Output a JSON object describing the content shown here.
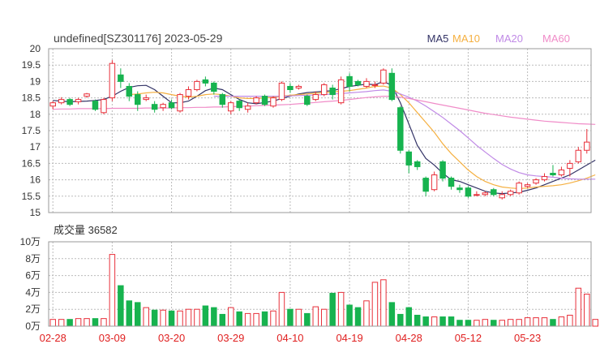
{
  "header": {
    "title": "undefined[SZ301176] 2023-05-29",
    "legend": [
      {
        "label": "MA5",
        "color": "#333366"
      },
      {
        "label": "MA10",
        "color": "#f5b041"
      },
      {
        "label": "MA20",
        "color": "#c08ae6"
      },
      {
        "label": "MA60",
        "color": "#f08cc8"
      }
    ]
  },
  "volume_panel": {
    "label": "成交量 36582"
  },
  "colors": {
    "up": "#e8303a",
    "down": "#17b34f",
    "grid": "#bbbbbb",
    "axis_text": "#333333",
    "date_text": "#e02020"
  },
  "chart_data": [
    {
      "type": "candlestick",
      "title": "undefined[SZ301176] 2023-05-29",
      "ylim": [
        15,
        20
      ],
      "yticks": [
        "20",
        "19.5",
        "19",
        "18.5",
        "18",
        "17.5",
        "17",
        "16.5",
        "16",
        "15.5",
        "15"
      ],
      "x_tick_labels": [
        {
          "index": 0,
          "label": "02-28"
        },
        {
          "index": 7,
          "label": "03-09"
        },
        {
          "index": 14,
          "label": "03-20"
        },
        {
          "index": 21,
          "label": "03-29"
        },
        {
          "index": 28,
          "label": "04-10"
        },
        {
          "index": 35,
          "label": "04-19"
        },
        {
          "index": 42,
          "label": "04-28"
        },
        {
          "index": 49,
          "label": "05-12"
        },
        {
          "index": 56,
          "label": "05-23"
        }
      ],
      "candles": [
        [
          18.25,
          18.35,
          18.15,
          18.4
        ],
        [
          18.35,
          18.45,
          18.3,
          18.52
        ],
        [
          18.45,
          18.3,
          18.25,
          18.5
        ],
        [
          18.38,
          18.45,
          18.3,
          18.5
        ],
        [
          18.55,
          18.62,
          18.5,
          18.65
        ],
        [
          18.4,
          18.15,
          18.1,
          18.45
        ],
        [
          18.05,
          18.45,
          18.0,
          18.5
        ],
        [
          18.5,
          19.55,
          18.4,
          19.65
        ],
        [
          19.2,
          19.0,
          18.8,
          19.4
        ],
        [
          18.85,
          18.55,
          18.4,
          18.95
        ],
        [
          18.6,
          18.3,
          18.1,
          18.7
        ],
        [
          18.45,
          18.5,
          18.4,
          18.6
        ],
        [
          18.3,
          18.15,
          18.05,
          18.4
        ],
        [
          18.2,
          18.3,
          18.1,
          18.35
        ],
        [
          18.35,
          18.2,
          18.15,
          18.45
        ],
        [
          18.1,
          18.6,
          18.05,
          18.65
        ],
        [
          18.55,
          18.75,
          18.45,
          18.85
        ],
        [
          18.75,
          19.0,
          18.7,
          19.05
        ],
        [
          19.05,
          18.95,
          18.85,
          19.15
        ],
        [
          18.95,
          18.7,
          18.6,
          19.0
        ],
        [
          18.6,
          18.3,
          18.2,
          18.65
        ],
        [
          18.1,
          18.35,
          18.0,
          18.4
        ],
        [
          18.4,
          18.2,
          18.1,
          18.45
        ],
        [
          18.15,
          18.25,
          18.05,
          18.35
        ],
        [
          18.35,
          18.5,
          18.3,
          18.55
        ],
        [
          18.55,
          18.3,
          18.25,
          18.6
        ],
        [
          18.25,
          18.5,
          18.2,
          18.55
        ],
        [
          18.45,
          18.95,
          18.4,
          19.0
        ],
        [
          18.85,
          18.75,
          18.65,
          18.95
        ],
        [
          18.8,
          18.85,
          18.75,
          18.9
        ],
        [
          18.55,
          18.3,
          18.25,
          18.6
        ],
        [
          18.45,
          18.6,
          18.4,
          18.7
        ],
        [
          18.6,
          18.9,
          18.55,
          18.95
        ],
        [
          18.8,
          18.6,
          18.45,
          18.9
        ],
        [
          18.35,
          19.05,
          18.3,
          19.15
        ],
        [
          19.15,
          18.85,
          18.7,
          19.25
        ],
        [
          19.0,
          18.9,
          18.85,
          19.05
        ],
        [
          18.85,
          19.0,
          18.8,
          19.1
        ],
        [
          18.9,
          18.9,
          18.8,
          19.0
        ],
        [
          18.95,
          19.35,
          18.9,
          19.4
        ],
        [
          19.25,
          18.45,
          18.4,
          19.4
        ],
        [
          18.2,
          16.9,
          16.8,
          18.25
        ],
        [
          16.85,
          16.45,
          16.2,
          16.9
        ],
        [
          16.55,
          16.4,
          16.3,
          16.6
        ],
        [
          16.05,
          15.65,
          15.5,
          16.1
        ],
        [
          15.7,
          16.15,
          15.65,
          16.25
        ],
        [
          16.55,
          16.05,
          15.95,
          16.6
        ],
        [
          16.05,
          15.8,
          15.7,
          16.1
        ],
        [
          15.75,
          15.7,
          15.6,
          15.85
        ],
        [
          15.75,
          15.5,
          15.45,
          15.8
        ],
        [
          15.55,
          15.55,
          15.5,
          15.65
        ],
        [
          15.55,
          15.6,
          15.5,
          15.65
        ],
        [
          15.7,
          15.55,
          15.5,
          15.75
        ],
        [
          15.45,
          15.55,
          15.4,
          15.65
        ],
        [
          15.55,
          15.65,
          15.5,
          15.7
        ],
        [
          15.6,
          15.9,
          15.55,
          15.95
        ],
        [
          15.8,
          15.85,
          15.75,
          15.9
        ],
        [
          15.9,
          16.0,
          15.85,
          16.05
        ],
        [
          16.0,
          16.1,
          15.95,
          16.2
        ],
        [
          16.2,
          16.15,
          16.1,
          16.45
        ],
        [
          16.15,
          16.3,
          16.1,
          16.4
        ],
        [
          16.35,
          16.5,
          16.1,
          16.6
        ],
        [
          16.55,
          16.9,
          16.5,
          17.0
        ],
        [
          16.9,
          17.15,
          16.8,
          17.55
        ]
      ],
      "ma_series": [
        {
          "name": "MA5",
          "color": "#333366",
          "values": [
            18.42,
            18.4,
            18.38,
            18.39,
            18.4,
            18.42,
            18.45,
            18.55,
            18.7,
            18.82,
            18.87,
            18.88,
            18.75,
            18.55,
            18.35,
            18.35,
            18.4,
            18.55,
            18.72,
            18.8,
            18.75,
            18.6,
            18.45,
            18.35,
            18.32,
            18.36,
            18.4,
            18.48,
            18.55,
            18.62,
            18.66,
            18.68,
            18.7,
            18.72,
            18.78,
            18.85,
            18.88,
            18.92,
            18.9,
            19.0,
            18.88,
            18.35,
            17.7,
            17.05,
            16.65,
            16.45,
            16.2,
            16.0,
            15.95,
            15.85,
            15.75,
            15.65,
            15.6,
            15.58,
            15.6,
            15.62,
            15.68,
            15.75,
            15.85,
            15.95,
            16.05,
            16.15,
            16.3,
            16.45,
            16.6
          ]
        },
        {
          "name": "MA10",
          "color": "#f5b041",
          "values": [
            null,
            null,
            null,
            null,
            null,
            null,
            null,
            null,
            null,
            18.6,
            18.62,
            18.65,
            18.67,
            18.65,
            18.6,
            18.55,
            18.52,
            18.55,
            18.6,
            18.62,
            18.6,
            18.55,
            18.5,
            18.48,
            18.48,
            18.5,
            18.52,
            18.55,
            18.58,
            18.6,
            18.62,
            18.64,
            18.66,
            18.68,
            18.7,
            18.72,
            18.76,
            18.8,
            18.85,
            18.86,
            18.8,
            18.6,
            18.35,
            18.05,
            17.75,
            17.45,
            17.1,
            16.8,
            16.55,
            16.3,
            16.1,
            15.95,
            15.85,
            15.78,
            15.75,
            15.73,
            15.75,
            15.78,
            15.8,
            15.82,
            15.85,
            15.9,
            15.97,
            16.05,
            16.15
          ]
        },
        {
          "name": "MA20",
          "color": "#c08ae6",
          "values": [
            null,
            null,
            null,
            null,
            null,
            null,
            null,
            null,
            null,
            null,
            null,
            null,
            null,
            null,
            null,
            null,
            null,
            null,
            null,
            18.55,
            18.55,
            18.55,
            18.55,
            18.55,
            18.55,
            18.55,
            18.55,
            18.55,
            18.56,
            18.57,
            18.58,
            18.59,
            18.6,
            18.62,
            18.63,
            18.65,
            18.67,
            18.69,
            18.72,
            18.74,
            18.7,
            18.62,
            18.52,
            18.4,
            18.25,
            18.08,
            17.9,
            17.7,
            17.5,
            17.28,
            17.05,
            16.85,
            16.65,
            16.47,
            16.33,
            16.22,
            16.15,
            16.12,
            16.1,
            16.08,
            16.05,
            16.03,
            16.02,
            16.02,
            16.02
          ]
        },
        {
          "name": "MA60",
          "color": "#f08cc8",
          "values": [
            18.15,
            18.16,
            18.16,
            18.17,
            18.17,
            18.17,
            18.17,
            18.18,
            18.18,
            18.18,
            18.18,
            18.19,
            18.19,
            18.19,
            18.19,
            18.2,
            18.2,
            18.21,
            18.21,
            18.22,
            18.22,
            18.23,
            18.24,
            18.25,
            18.26,
            18.27,
            18.28,
            18.29,
            18.3,
            18.32,
            18.34,
            18.36,
            18.38,
            18.4,
            18.42,
            18.45,
            18.48,
            18.51,
            18.53,
            18.55,
            18.55,
            18.52,
            18.48,
            18.43,
            18.38,
            18.33,
            18.28,
            18.23,
            18.18,
            18.13,
            18.08,
            18.03,
            17.99,
            17.95,
            17.91,
            17.88,
            17.85,
            17.82,
            17.79,
            17.77,
            17.75,
            17.73,
            17.71,
            17.7,
            17.69
          ]
        }
      ]
    },
    {
      "type": "bar",
      "title": "成交量 36582",
      "ylim": [
        0,
        100000
      ],
      "yticks": [
        "10万",
        "8万",
        "6万",
        "4万",
        "2万",
        "0万"
      ],
      "values": [
        8000,
        8000,
        8000,
        9000,
        9000,
        9000,
        9000,
        85000,
        48000,
        30000,
        28000,
        22000,
        19000,
        19000,
        18000,
        18000,
        20000,
        20000,
        24000,
        22000,
        14000,
        22000,
        17000,
        15000,
        15000,
        17000,
        18000,
        40000,
        20000,
        20000,
        15000,
        23000,
        20000,
        39000,
        40000,
        25000,
        22000,
        30000,
        52000,
        55000,
        28000,
        14000,
        22000,
        13000,
        11000,
        11000,
        11000,
        11000,
        7000,
        7000,
        7000,
        8000,
        7000,
        7000,
        8000,
        8000,
        10000,
        10000,
        10000,
        8000,
        11000,
        13000,
        45000,
        38000,
        8000
      ]
    }
  ]
}
